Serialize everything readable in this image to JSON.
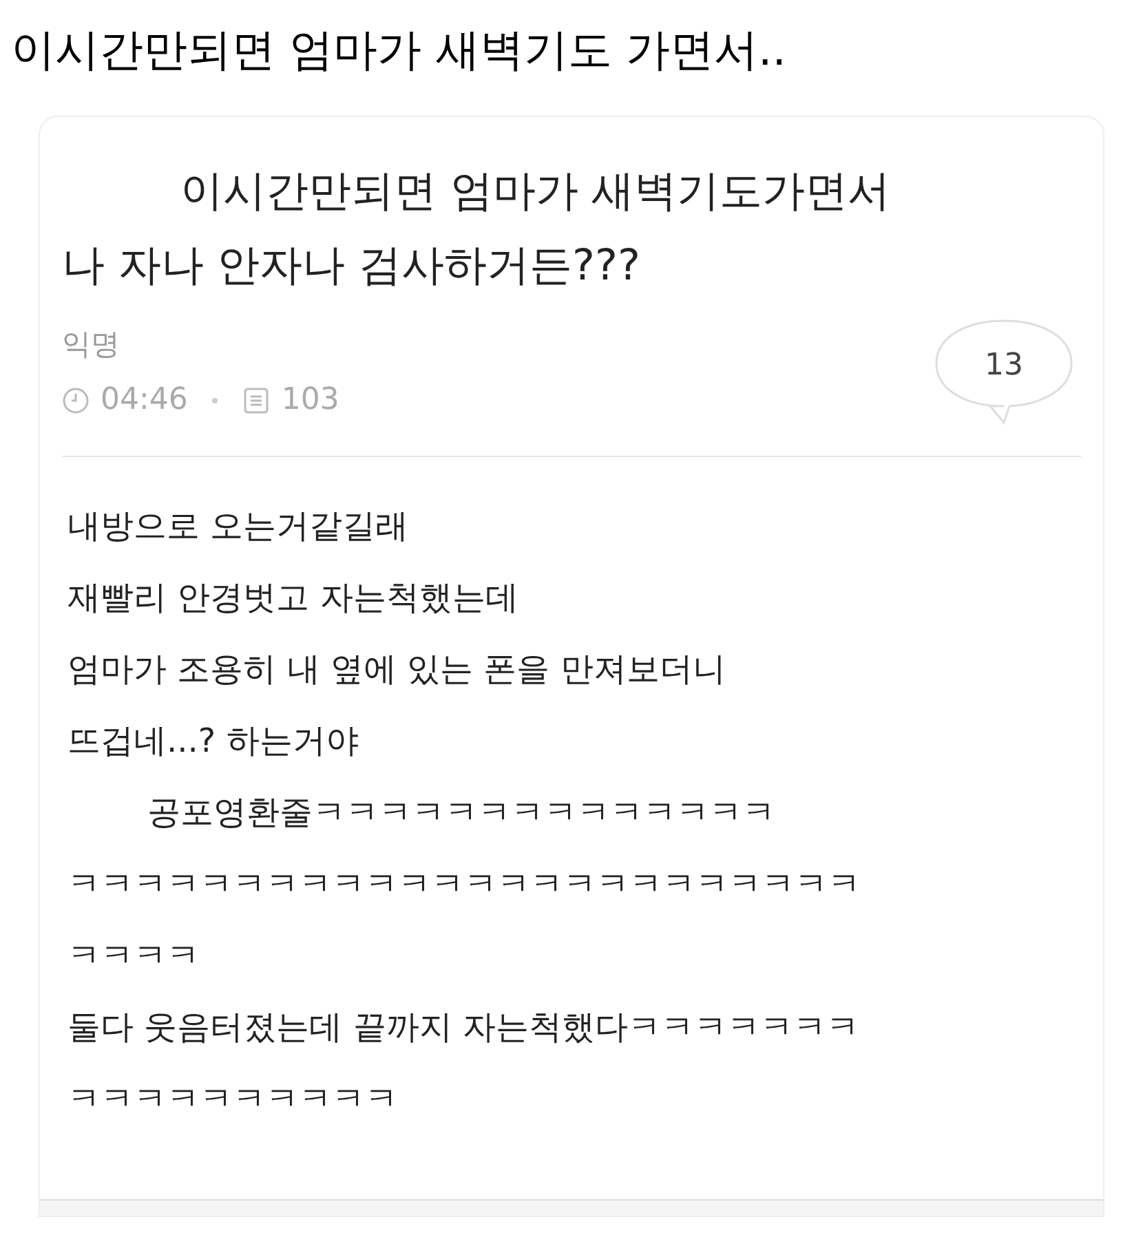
{
  "heading": "이시간만되면 엄마가 새벽기도 가면서..",
  "post": {
    "title_lines": [
      "이시간만되면 엄마가 새벽기도가면서",
      "나 자나 안자나 검사하거든???"
    ],
    "author": "익명",
    "time": "04:46",
    "views": "103",
    "comments": "13",
    "body_lines": [
      "내방으로 오는거같길래",
      "재빨리 안경벗고 자는척했는데",
      "엄마가 조용히 내 옆에 있는 폰을 만져보더니",
      "뜨겁네...? 하는거야",
      "공포영환줄ㅋㅋㅋㅋㅋㅋㅋㅋㅋㅋㅋㅋㅋㅋ",
      "ㅋㅋㅋㅋㅋㅋㅋㅋㅋㅋㅋㅋㅋㅋㅋㅋㅋㅋㅋㅋㅋㅋㅋㅋ",
      "ㅋㅋㅋㅋ",
      "둘다 웃음터졌는데 끝까지 자는척했다ㅋㅋㅋㅋㅋㅋㅋ",
      "ㅋㅋㅋㅋㅋㅋㅋㅋㅋㅋ"
    ]
  }
}
